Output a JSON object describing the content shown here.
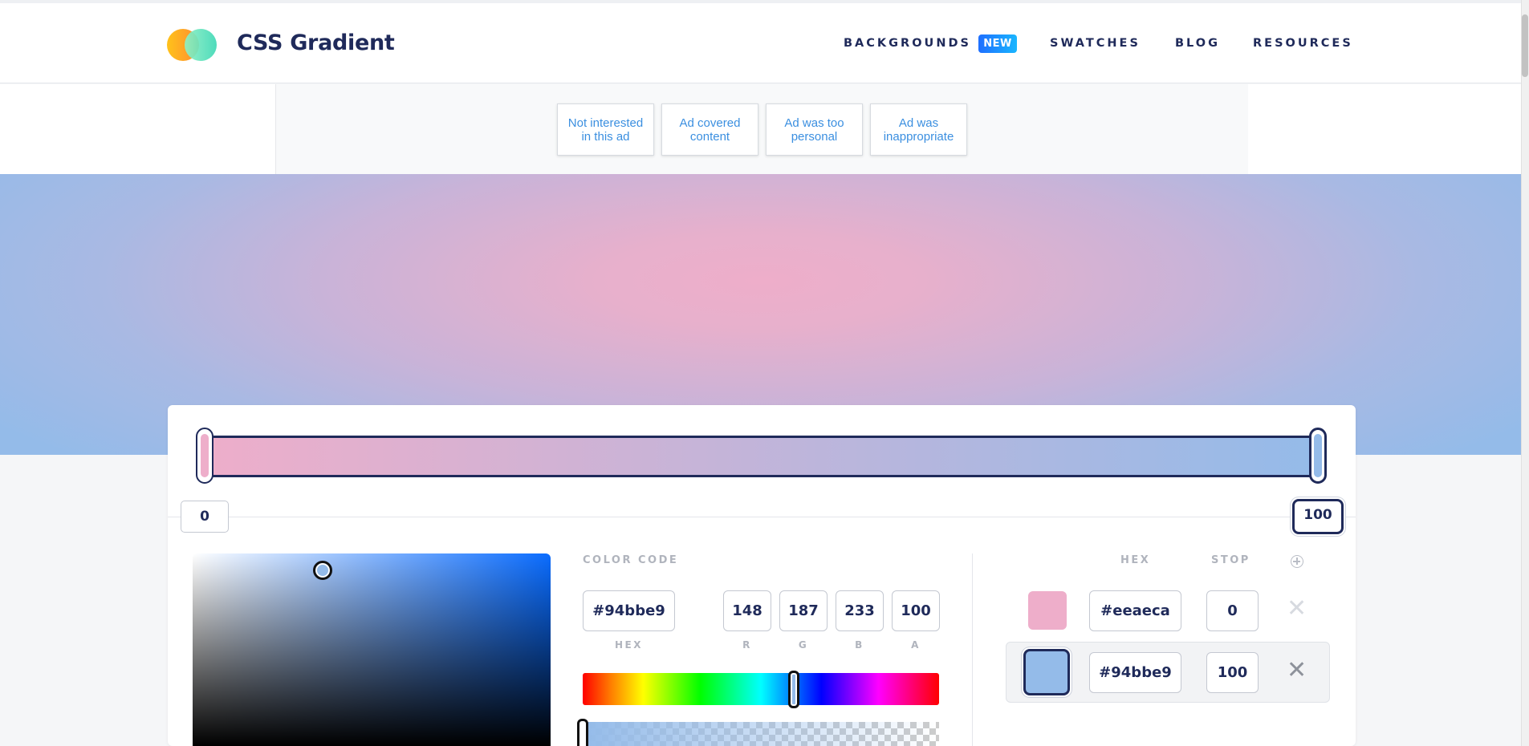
{
  "header": {
    "brand": "CSS Gradient",
    "nav": [
      {
        "label": "BACKGROUNDS"
      },
      {
        "label": "SWATCHES"
      },
      {
        "label": "BLOG"
      },
      {
        "label": "RESOURCES"
      }
    ],
    "badge": "NEW"
  },
  "ad_feedback": [
    {
      "label": "Not interested in this ad"
    },
    {
      "label": "Ad covered content"
    },
    {
      "label": "Ad was too personal"
    },
    {
      "label": "Ad was inappropriate"
    }
  ],
  "gradient": {
    "type": "radial",
    "stops": [
      {
        "hex": "#eeaeca",
        "stop": "0"
      },
      {
        "hex": "#94bbe9",
        "stop": "100"
      }
    ],
    "active_stop": 1
  },
  "picker": {
    "section_label": "COLOR CODE",
    "hex": "#94bbe9",
    "r": "148",
    "g": "187",
    "b": "233",
    "a": "100",
    "labels": {
      "hex": "HEX",
      "r": "R",
      "g": "G",
      "b": "B",
      "a": "A"
    }
  },
  "stops_table": {
    "hex_header": "HEX",
    "stop_header": "STOP",
    "remove_glyph": "✕",
    "add_icon": "add-stop-icon"
  },
  "colors": {
    "navy": "#1f2a5a",
    "muted_label": "#b0b4bd",
    "link_blue": "#3b8fe0"
  }
}
